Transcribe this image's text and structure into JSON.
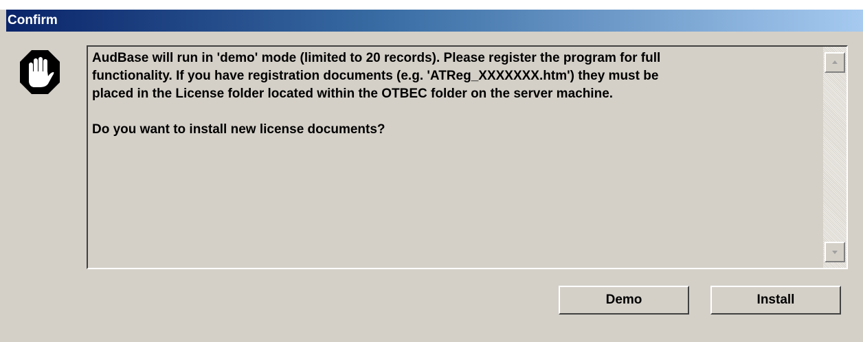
{
  "window": {
    "title": "Confirm",
    "icon": "stop-hand-icon"
  },
  "message": {
    "lines": [
      "AudBase will run in 'demo' mode (limited to 20 records).  Please register the program for full",
      "functionality.  If you have registration documents (e.g. 'ATReg_XXXXXXX.htm') they must be",
      "placed in the License folder located within the OTBEC folder on the server machine."
    ],
    "question": "Do you want to install new license documents?"
  },
  "buttons": {
    "demo_label": "Demo",
    "install_label": "Install"
  },
  "colors": {
    "titlebar_start": "#0a246a",
    "titlebar_end": "#a6caf0",
    "dialog_face": "#d4d0c8"
  }
}
